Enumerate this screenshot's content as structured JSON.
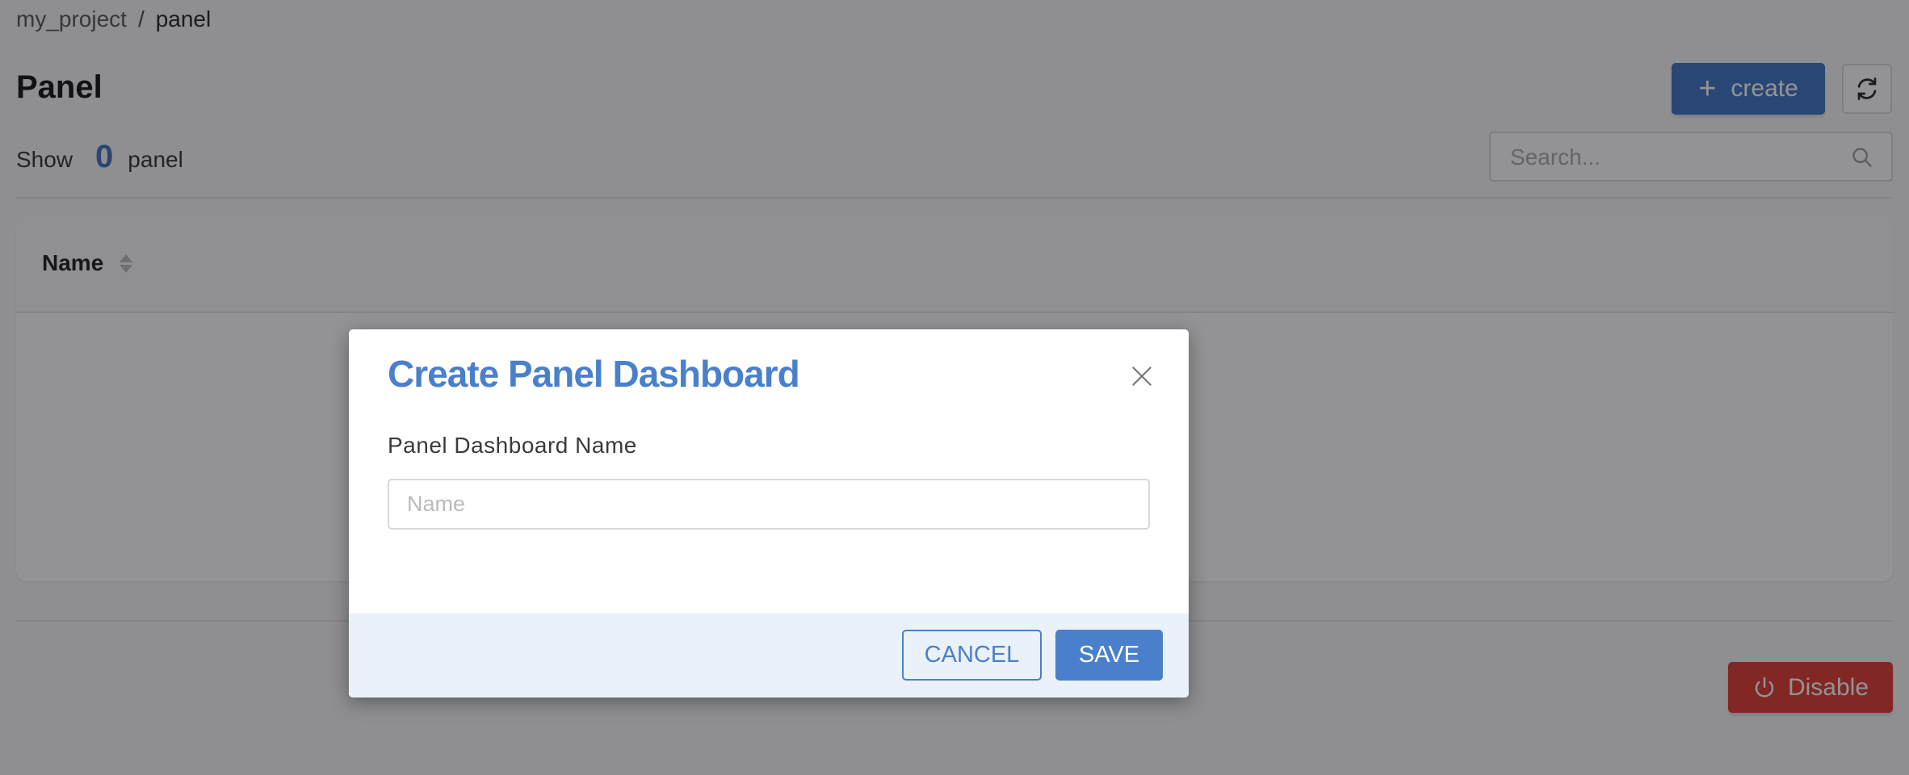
{
  "breadcrumb": {
    "items": [
      "my_project",
      "panel"
    ],
    "separator": "/"
  },
  "header": {
    "title": "Panel",
    "count_prefix": "Show",
    "count_value": "0",
    "count_suffix": "panel",
    "create_label": "create",
    "create_icon": "plus-icon",
    "refresh_icon": "refresh-icon"
  },
  "search": {
    "placeholder": "Search...",
    "value": "",
    "icon": "search-icon"
  },
  "table": {
    "columns": [
      {
        "label": "Name",
        "sortable": true
      }
    ],
    "rows": []
  },
  "footer": {
    "disable_label": "Disable",
    "disable_icon": "power-icon"
  },
  "modal": {
    "title": "Create Panel Dashboard",
    "field_label": "Panel Dashboard Name",
    "input_placeholder": "Name",
    "input_value": "",
    "cancel_label": "CANCEL",
    "save_label": "SAVE",
    "close_icon": "close-icon"
  },
  "colors": {
    "accent": "#4a80cb",
    "primary_button": "#3e72c4",
    "danger": "#e0392e",
    "modal_footer_bg": "#ebf1f9"
  }
}
